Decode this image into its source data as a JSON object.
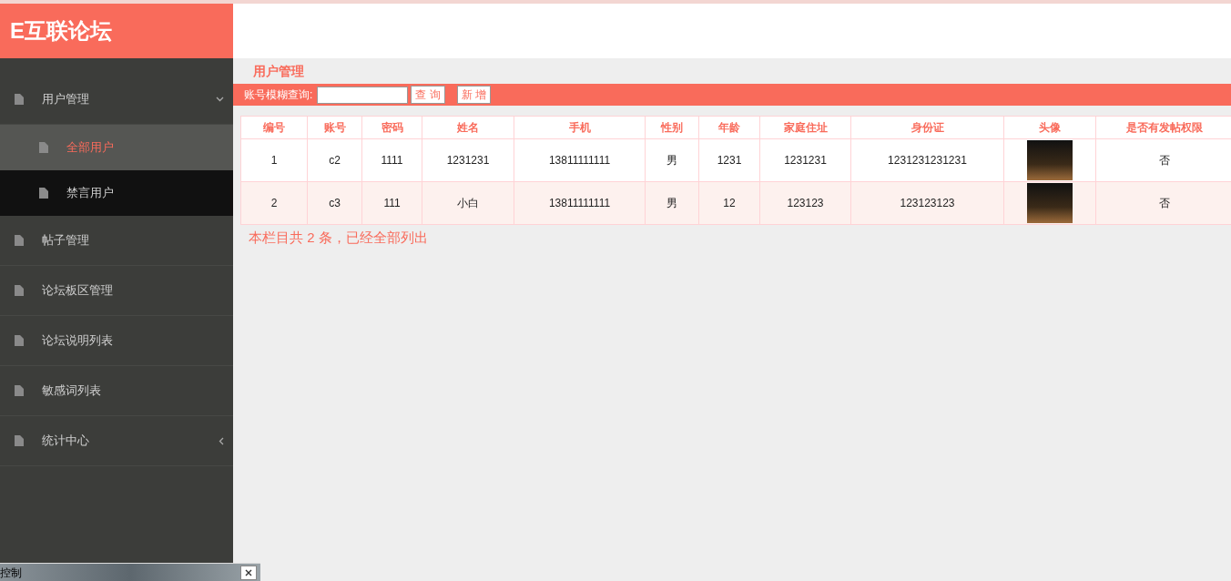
{
  "logo": "E互联论坛",
  "sidebar": {
    "items": [
      {
        "label": "用户管理",
        "kind": "folder",
        "expanded": true,
        "children": [
          {
            "label": "全部用户",
            "selected": true
          },
          {
            "label": "禁言用户",
            "selected": false
          }
        ]
      },
      {
        "label": "帖子管理",
        "kind": "link"
      },
      {
        "label": "论坛板区管理",
        "kind": "link"
      },
      {
        "label": "论坛说明列表",
        "kind": "link"
      },
      {
        "label": "敏感词列表",
        "kind": "link"
      },
      {
        "label": "统计中心",
        "kind": "folder",
        "expanded": false
      }
    ]
  },
  "page_title": "用户管理",
  "toolbar": {
    "search_label": "账号模糊查询:",
    "search_button": "查 询",
    "add_button": "新 增"
  },
  "table": {
    "columns": [
      "编号",
      "账号",
      "密码",
      "姓名",
      "手机",
      "性别",
      "年龄",
      "家庭住址",
      "身份证",
      "头像",
      "是否有发帖权限"
    ],
    "rows": [
      {
        "cells": [
          "1",
          "c2",
          "1111",
          "1231231",
          "13811111111",
          "男",
          "1231",
          "1231231",
          "1231231231231",
          null,
          "否"
        ]
      },
      {
        "cells": [
          "2",
          "c3",
          "111",
          "小白",
          "13811111111",
          "男",
          "12",
          "123123",
          "123123123",
          null,
          "否"
        ]
      }
    ]
  },
  "footer_note": "本栏目共 2 条，已经全部列出",
  "taskbar": {
    "title": "控制"
  }
}
